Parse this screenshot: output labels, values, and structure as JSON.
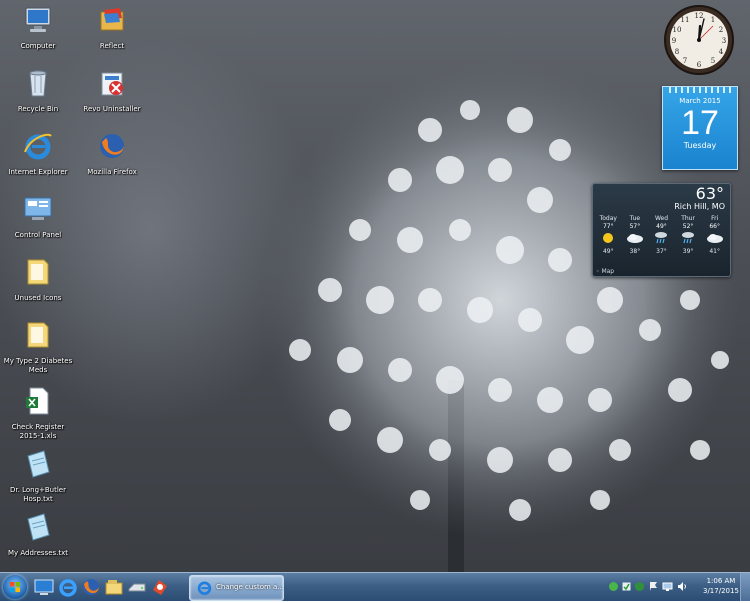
{
  "desktop": {
    "icons": [
      {
        "label": "Computer",
        "icon": "computer-icon"
      },
      {
        "label": "Reflect",
        "icon": "reflect-icon"
      },
      {
        "label": "Recycle Bin",
        "icon": "recycle-bin-icon"
      },
      {
        "label": "Revo Uninstaller",
        "icon": "revo-uninstaller-icon"
      },
      {
        "label": "Internet Explorer",
        "icon": "internet-explorer-icon"
      },
      {
        "label": "Mozilla Firefox",
        "icon": "firefox-icon"
      },
      {
        "label": "Control Panel",
        "icon": "control-panel-icon"
      },
      {
        "label": "Unused Icons",
        "icon": "folder-icon"
      },
      {
        "label": "My Type 2 Diabetes Meds",
        "icon": "folder-icon"
      },
      {
        "label": "Check Register 2015-1.xls",
        "icon": "excel-file-icon"
      },
      {
        "label": "Dr. Long+Butler Hosp.txt",
        "icon": "notepad-file-icon"
      },
      {
        "label": "My Addresses.txt",
        "icon": "notepad-file-icon"
      }
    ]
  },
  "gadgets": {
    "calendar": {
      "month": "March 2015",
      "day": "17",
      "weekday": "Tuesday"
    },
    "weather": {
      "temperature": "63°",
      "location": "Rich Hill, MO",
      "map_label": "Map",
      "days": [
        {
          "name": "Today",
          "high": "77°",
          "low": "49°",
          "condition": "sunny-icon"
        },
        {
          "name": "Tue",
          "high": "57°",
          "low": "38°",
          "condition": "cloudy-icon"
        },
        {
          "name": "Wed",
          "high": "49°",
          "low": "37°",
          "condition": "rain-icon"
        },
        {
          "name": "Thur",
          "high": "52°",
          "low": "39°",
          "condition": "rain-icon"
        },
        {
          "name": "Fri",
          "high": "66°",
          "low": "41°",
          "condition": "cloudy-icon"
        }
      ]
    }
  },
  "taskbar": {
    "active_window_title": "Change custom a...",
    "time": "1:06 AM",
    "date": "3/17/2015",
    "pinned": [
      "desktop-icon",
      "internet-explorer-icon",
      "firefox-icon",
      "windows-explorer-icon",
      "drive-icon",
      "revo-icon"
    ]
  }
}
